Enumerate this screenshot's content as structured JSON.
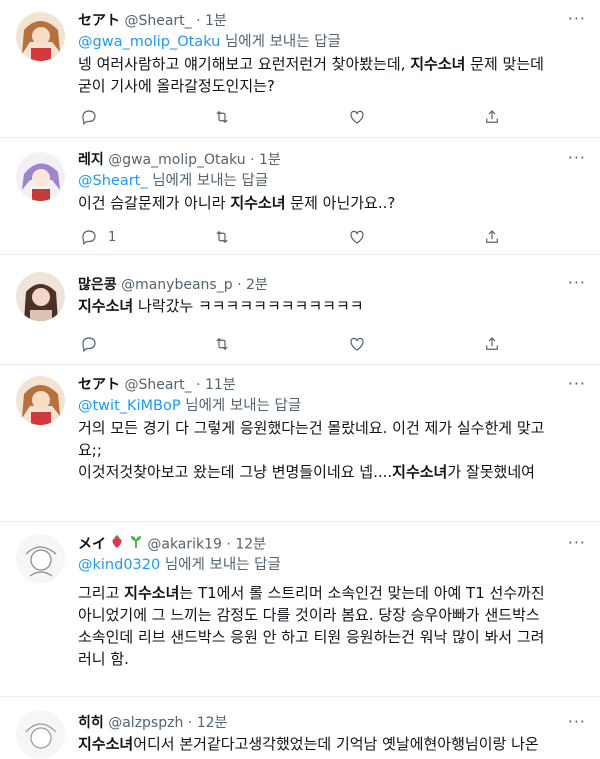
{
  "reply_prefix_suffix": "님에게 보내는 답글",
  "tweets": [
    {
      "name": "セアト",
      "handle": "@Sheart_",
      "dot": "·",
      "time": "1분",
      "reply_to": "@gwa_molip_Otaku",
      "text_parts": [
        "넹 여러사람하고 얘기해보고 요런저런거 찾아봤는데, ",
        "지수소녀",
        " 문제 맞는데\n굳이 기사에 올라갈정도인지는?"
      ],
      "reply_count": "",
      "avatar_color": "#c9855a"
    },
    {
      "name": "레지",
      "handle": "@gwa_molip_Otaku",
      "dot": "·",
      "time": "1분",
      "reply_to": "@Sheart_",
      "text_parts": [
        "이건 슴갈문제가 아니라 ",
        "지수소녀",
        " 문제 아닌가요..?"
      ],
      "reply_count": "1",
      "avatar_color": "#b79ad6"
    },
    {
      "name": "많은콩",
      "handle": "@manybeans_p",
      "dot": "·",
      "time": "2분",
      "reply_to": "",
      "text_parts": [
        "",
        "지수소녀",
        " 나락갔누 ㅋㅋㅋㅋㅋㅋㅋㅋㅋㅋㅋㅋ"
      ],
      "reply_count": "",
      "avatar_color": "#e8d2c4"
    },
    {
      "name": "セアト",
      "handle": "@Sheart_",
      "dot": "·",
      "time": "11분",
      "reply_to": "@twit_KiMBoP",
      "text_parts": [
        "거의 모든 경기 다 그렇게 응원했다는건 몰랐네요. 이건 제가 실수한게 맞고\n요;;\n이것저것찾아보고 왔는데 그냥 변명들이네요 넵....",
        "지수소녀",
        "가 잘못했네여"
      ],
      "reply_count": "",
      "avatar_color": "#c9855a"
    },
    {
      "name": "メイ",
      "handle": "@akarik19",
      "dot": "·",
      "time": "12분",
      "reply_to": "@kind0320",
      "text_parts": [
        "그리고 ",
        "지수소녀",
        "는 T1에서 롤 스트리머 소속인건 맞는데 아예 T1 선수까진\n아니었기에 그 느끼는 감정도 다를 것이라 봄요. 당장 승우아빠가 샌드박스\n소속인데 리브 샌드박스 응원 안 하고 티원 응원하는건 워낙 많이 봐서 그려\n러니 함."
      ],
      "reply_count": "",
      "avatar_color": "#eeeeee"
    },
    {
      "name": "히히",
      "handle": "@alzpspzh",
      "dot": "·",
      "time": "12분",
      "reply_to": "",
      "text_parts": [
        "",
        "지수소녀",
        "어디서 본거같다고생각했었는데 기억남 옛날에현아행님이랑 나온"
      ],
      "reply_count": "",
      "avatar_color": "#eeeeee"
    }
  ]
}
